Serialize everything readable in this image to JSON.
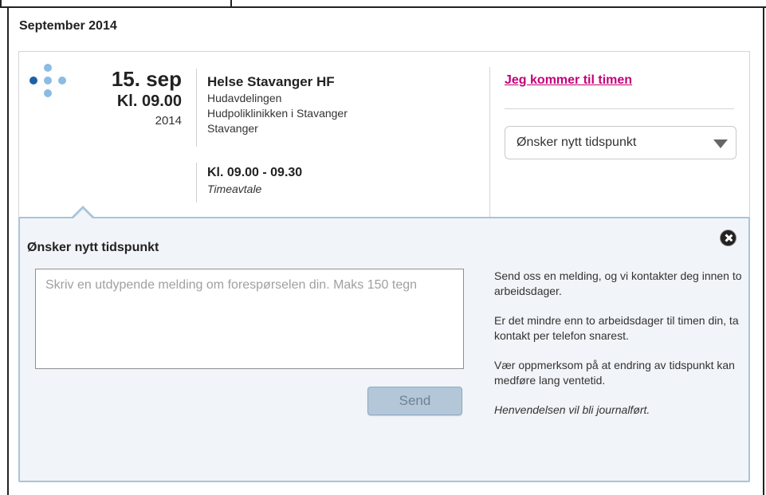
{
  "month_header": "September 2014",
  "appointment": {
    "day": "15. sep",
    "time": "Kl. 09.00",
    "year": "2014",
    "provider_name": "Helse Stavanger HF",
    "department": "Hudavdelingen",
    "clinic": "Hudpoliklinikken i Stavanger",
    "city": "Stavanger",
    "time_range": "Kl. 09.00 - 09.30",
    "type": "Timeavtale"
  },
  "actions": {
    "attend_link": "Jeg kommer til timen",
    "select_value": "Ønsker nytt tidspunkt"
  },
  "panel": {
    "title": "Ønsker nytt tidspunkt",
    "message_placeholder": "Skriv en utdypende melding om forespørselen din. Maks 150 tegn",
    "message_value": "",
    "send_label": "Send",
    "info_1": "Send oss en melding, og vi kontakter deg innen to arbeidsdager.",
    "info_2": "Er det mindre enn to arbeidsdager til timen din, ta kontakt per telefon snarest.",
    "info_3": "Vær oppmerksom på at endring av tidspunkt kan medføre lang ventetid.",
    "info_4": "Henvendelsen vil bli journalført."
  },
  "colors": {
    "link": "#c4007a",
    "dot_dark": "#1f5fa8",
    "dot_light": "#8cbbe3",
    "panel_bg": "#f1f4f8",
    "panel_border": "#a9c4dc",
    "send_bg": "#b3c7d8"
  },
  "icons": {
    "logo": "dots-logo-icon",
    "close": "close-icon",
    "dropdown": "chevron-down-icon"
  }
}
